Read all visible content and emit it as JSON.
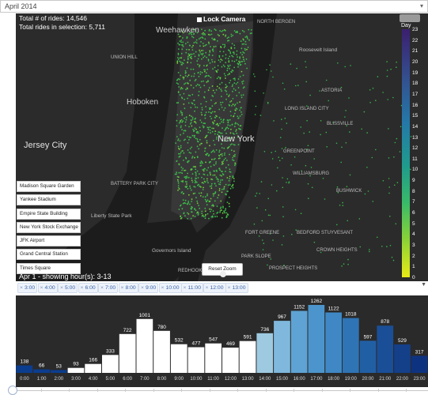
{
  "month_selector": {
    "value": "April 2014",
    "caret": "▾"
  },
  "map": {
    "total_rides": "Total # of rides: 14,546",
    "total_selection": "Total rides in selection: 5,711",
    "lock_camera": "Lock Camera",
    "legend_title": "Day",
    "legend_ticks": [
      "23",
      "22",
      "21",
      "20",
      "19",
      "18",
      "17",
      "16",
      "15",
      "14",
      "13",
      "12",
      "11",
      "10",
      "9",
      "8",
      "7",
      "6",
      "5",
      "4",
      "3",
      "2",
      "1",
      "0"
    ],
    "place_labels": {
      "weehawken": "Weehawken",
      "hoboken": "Hoboken",
      "jersey_city": "Jersey City",
      "new_york": "New York",
      "union_hill": "UNION HILL",
      "north_bergen": "NORTH BERGEN",
      "roosevelt_island": "Roosevelt Island",
      "astoria": "ASTORIA",
      "long_island_city": "LONG ISLAND CITY",
      "blissville": "BLISSVILLE",
      "greenpoint": "GREENPOINT",
      "williamsburg": "WILLIAMSBURG",
      "bushwick": "BUSHWICK",
      "battery_park": "BATTERY PARK CITY",
      "liberty_state_park": "Liberty State Park",
      "governors_island": "Governors Island",
      "redhook": "REDHOOK",
      "fort_greene": "FORT GREENE",
      "bedford_stuyvesant": "BEDFORD STUYVESANT",
      "crown_heights": "CROWN HEIGHTS",
      "park_slope": "PARK SLOPE",
      "prospect_heights": "PROSPECT HEIGHTS"
    },
    "locations": [
      "Madison Square Garden",
      "Yankee Stadium",
      "Empire State Building",
      "New York Stock Exchange",
      "JFK Airport",
      "Grand Central Station",
      "Times Square"
    ],
    "date_hours": "Apr 1 - showing hour(s): 3-13",
    "reset_zoom": "Reset Zoom"
  },
  "hour_chips": [
    "3:00",
    "4:00",
    "5:00",
    "6:00",
    "7:00",
    "8:00",
    "9:00",
    "10:00",
    "11:00",
    "12:00",
    "13:00"
  ],
  "chip_remove_glyph": "×",
  "chart_data": {
    "type": "bar",
    "categories": [
      "0:00",
      "1:00",
      "2:00",
      "3:00",
      "4:00",
      "5:00",
      "6:00",
      "7:00",
      "8:00",
      "9:00",
      "10:00",
      "11:00",
      "12:00",
      "13:00",
      "14:00",
      "15:00",
      "16:00",
      "17:00",
      "18:00",
      "19:00",
      "20:00",
      "21:00",
      "22:00",
      "23:00"
    ],
    "values": [
      138,
      66,
      53,
      93,
      166,
      333,
      722,
      1001,
      780,
      532,
      477,
      547,
      469,
      591,
      736,
      967,
      1152,
      1262,
      1122,
      1018,
      597,
      878,
      529,
      317
    ],
    "ylim": [
      0,
      1262
    ],
    "selected_hours": [
      3,
      4,
      5,
      6,
      7,
      8,
      9,
      10,
      11,
      12,
      13
    ],
    "colors": {
      "selected": "#ffffff",
      "unselected": [
        "#0b3d8f",
        "#0b3d8f",
        "#0b3d8f",
        "#ffffff",
        "#ffffff",
        "#ffffff",
        "#ffffff",
        "#ffffff",
        "#ffffff",
        "#ffffff",
        "#ffffff",
        "#ffffff",
        "#ffffff",
        "#ffffff",
        "#9ecae1",
        "#7fb8dc",
        "#5ea3d3",
        "#4c95cc",
        "#3f88c5",
        "#2f74b5",
        "#215fa4",
        "#1a4f97",
        "#143f89",
        "#0d3380"
      ]
    },
    "background": "#2a2a2a"
  },
  "slider": {
    "value": 0
  }
}
